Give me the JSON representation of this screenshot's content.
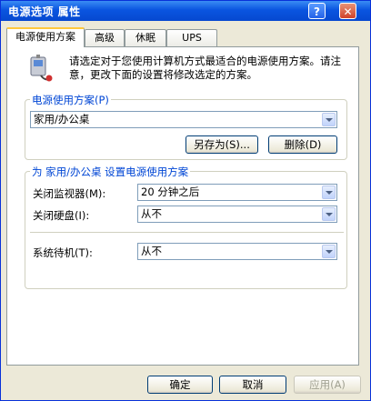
{
  "window": {
    "title": "电源选项 属性",
    "help_glyph": "?",
    "close_glyph": "✕"
  },
  "tabs": [
    {
      "label": "电源使用方案"
    },
    {
      "label": "高级"
    },
    {
      "label": "休眠"
    },
    {
      "label": "UPS"
    }
  ],
  "intro_text": "请选定对于您使用计算机方式最适合的电源使用方案。请注意，更改下面的设置将修改选定的方案。",
  "scheme_group": {
    "legend": "电源使用方案(P)",
    "selected": "家用/办公桌",
    "save_as_label": "另存为(S)...",
    "delete_label": "删除(D)"
  },
  "settings_group": {
    "legend": "为 家用/办公桌 设置电源使用方案",
    "monitor_label": "关闭监视器(M):",
    "monitor_value": "20 分钟之后",
    "harddisk_label": "关闭硬盘(I):",
    "harddisk_value": "从不",
    "standby_label": "系统待机(T):",
    "standby_value": "从不"
  },
  "buttons": {
    "ok": "确定",
    "cancel": "取消",
    "apply": "应用(A)"
  },
  "colors": {
    "titlebar": "#0a55e0",
    "legend": "#0046d5",
    "tab_highlight": "#ffc83c",
    "window_bg": "#ece9d8"
  }
}
